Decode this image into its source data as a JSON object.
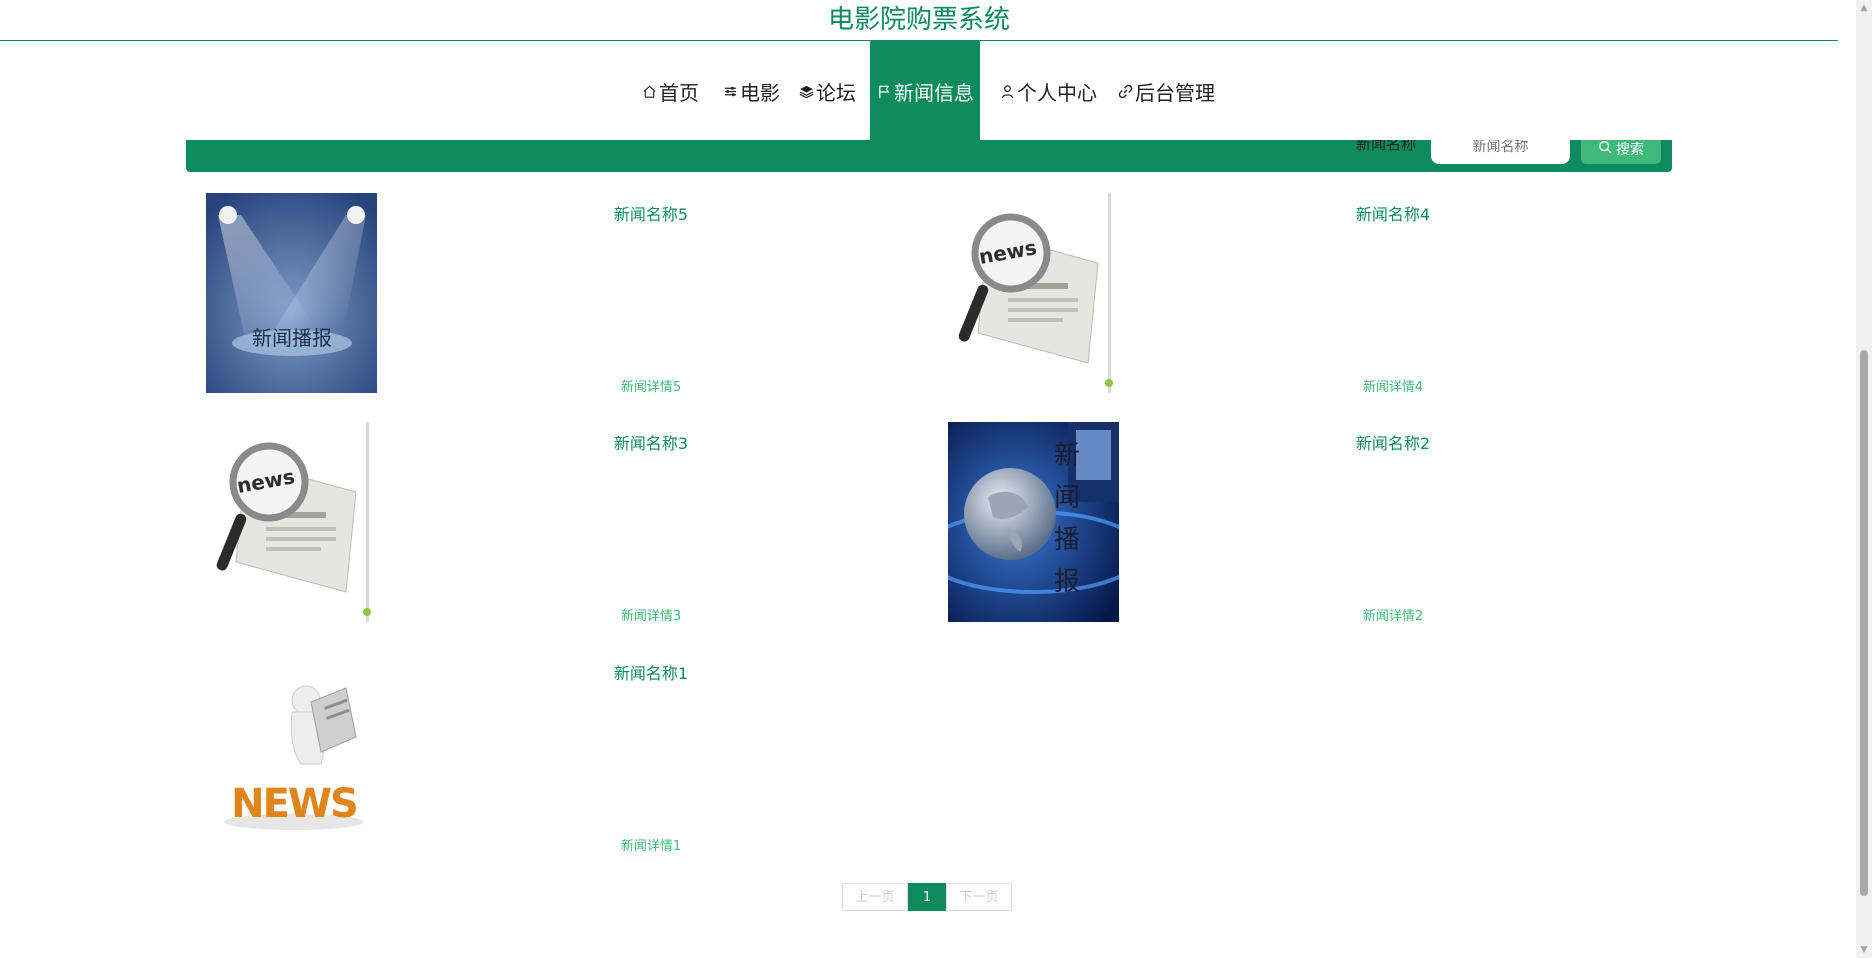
{
  "site": {
    "title": "电影院购票系统"
  },
  "nav": {
    "items": [
      {
        "label": "首页",
        "icon": "home-icon"
      },
      {
        "label": "电影",
        "icon": "sliders-icon"
      },
      {
        "label": "论坛",
        "icon": "layers-icon"
      },
      {
        "label": "新闻信息",
        "icon": "flag-icon",
        "active": true
      },
      {
        "label": "个人中心",
        "icon": "user-icon"
      },
      {
        "label": "后台管理",
        "icon": "link-icon"
      }
    ]
  },
  "search": {
    "label": "新闻名称",
    "placeholder": "新闻名称",
    "button_label": "搜索"
  },
  "news": [
    {
      "title": "新闻名称5",
      "detail": "新闻详情5",
      "thumb": "新闻播报"
    },
    {
      "title": "新闻名称4",
      "detail": "新闻详情4",
      "thumb": "news"
    },
    {
      "title": "新闻名称3",
      "detail": "新闻详情3",
      "thumb": "news"
    },
    {
      "title": "新闻名称2",
      "detail": "新闻详情2",
      "thumb": "新闻播报"
    },
    {
      "title": "新闻名称1",
      "detail": "新闻详情1",
      "thumb": "NEWS"
    }
  ],
  "pagination": {
    "prev_label": "上一页",
    "current": "1",
    "next_label": "下一页"
  },
  "colors": {
    "primary": "#0e8a5f",
    "accent": "#3fb97a",
    "text": "#222222"
  }
}
